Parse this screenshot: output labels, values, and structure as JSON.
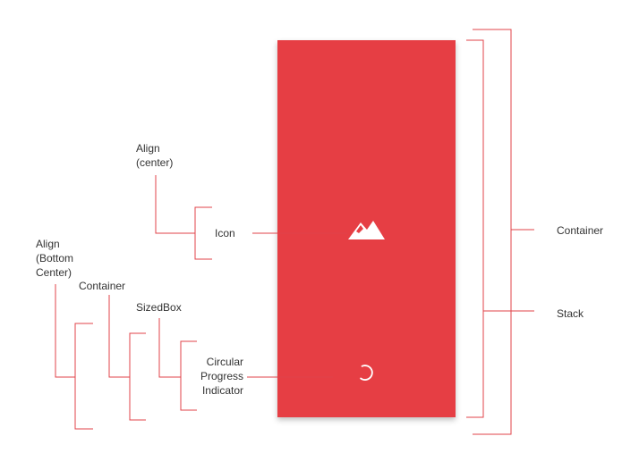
{
  "colors": {
    "primary": "#e63e44",
    "line": "#e0434a",
    "text": "#333333",
    "background": "#ffffff"
  },
  "labels": {
    "align_center": "Align\n(center)",
    "icon": "Icon",
    "align_bottom_center": "Align\n(Bottom\nCenter)",
    "container_left": "Container",
    "sized_box": "SizedBox",
    "circular_progress": "Circular\nProgress\nIndicator",
    "container_right": "Container",
    "stack": "Stack"
  },
  "icons": {
    "center_icon": "landscape-icon",
    "spinner": "circular-progress-icon"
  }
}
